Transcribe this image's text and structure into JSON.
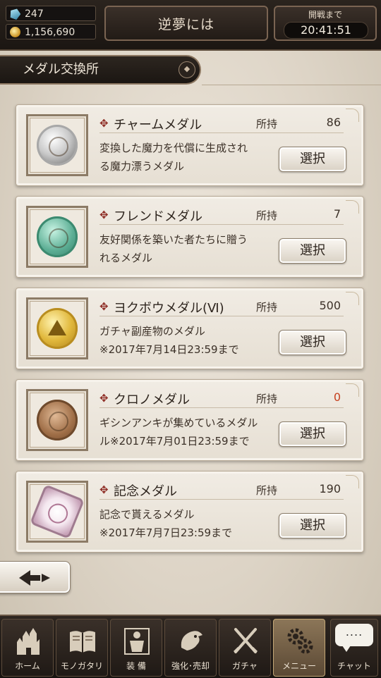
{
  "hud": {
    "crystal_count": "247",
    "gold_count": "1,156,690",
    "center_label": "逆夢には",
    "right_label": "開戦まで",
    "timer": "20:41:51"
  },
  "section": {
    "title": "メダル交換所",
    "sort_icon": "sort-icon"
  },
  "cards": [
    {
      "name": "チャームメダル",
      "owned_label": "所持",
      "owned": "86",
      "desc": [
        "変換した魔力を代償に生成され",
        "る魔力漂うメダル"
      ],
      "button": "選択",
      "icon": "charm-medal-icon"
    },
    {
      "name": "フレンドメダル",
      "owned_label": "所持",
      "owned": "7",
      "desc": [
        "友好関係を築いた者たちに贈う",
        "れるメダル"
      ],
      "button": "選択",
      "icon": "friend-medal-icon"
    },
    {
      "name": "ヨクボウメダル(Ⅵ)",
      "owned_label": "所持",
      "owned": "500",
      "desc": [
        "ガチャ副産物のメダル",
        "※2017年7月14日23:59まで"
      ],
      "button": "選択",
      "icon": "yokubou-medal-icon"
    },
    {
      "name": "クロノメダル",
      "owned_label": "所持",
      "owned": "0",
      "desc": [
        "ギシンアンキが集めているメダル",
        "ル※2017年7月01日23:59まで"
      ],
      "button": "選択",
      "icon": "chrono-medal-icon"
    },
    {
      "name": "記念メダル",
      "owned_label": "所持",
      "owned": "190",
      "desc": [
        "記念で貰えるメダル",
        "※2017年7月7日23:59まで"
      ],
      "button": "選択",
      "icon": "commemorative-medal-icon"
    }
  ],
  "nav": [
    {
      "label": "ホーム",
      "icon": "castle-icon"
    },
    {
      "label": "モノガタリ",
      "icon": "book-icon"
    },
    {
      "label": "装 備",
      "icon": "armor-icon"
    },
    {
      "label": "強化･売却",
      "icon": "dragon-icon"
    },
    {
      "label": "ガチャ",
      "icon": "swords-icon"
    },
    {
      "label": "メニュー",
      "icon": "gears-icon",
      "active": true
    },
    {
      "label": "チャット",
      "icon": "chat-bubble-icon",
      "bubble": "...."
    }
  ],
  "colors": {
    "zero_count": "#c6401f",
    "accent_cross": "#8d2a22",
    "active_tab": "#8c7658"
  }
}
